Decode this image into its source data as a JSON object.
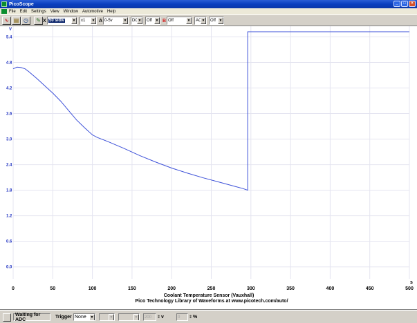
{
  "window": {
    "title": "PicoScope",
    "buttons": {
      "minimize": "_",
      "maximize": "□",
      "close": "×"
    }
  },
  "menu": [
    "File",
    "Edit",
    "Settings",
    "View",
    "Window",
    "Automotive",
    "Help"
  ],
  "toolbar": {
    "timebase": "50 s/div",
    "multiplier": "x1",
    "channel_a_label": "A",
    "channel_a_range": "0-5v",
    "channel_a_coupling": "DC",
    "channel_a_mode": "Off",
    "channel_b_label": "B",
    "channel_b_range": "Off",
    "channel_b_coupling": "AC",
    "channel_b_mode": "Off",
    "x_label": "X",
    "channel_a_color": "#1c3fd6",
    "channel_b_color": "#d42020"
  },
  "chart_data": {
    "type": "line",
    "title": "Coolant Temperature Sensor (Vauxhall)",
    "subtitle": "Pico Technology Library of Waveforms at www.picotech.com/auto/",
    "ylabel": "V",
    "xlabel": "s",
    "xlim": [
      0,
      500
    ],
    "ylim": [
      -0.28,
      5.65
    ],
    "xticks": [
      0,
      50,
      100,
      150,
      200,
      250,
      300,
      350,
      400,
      450,
      500
    ],
    "yticks": [
      "5.4",
      "4.8",
      "4.2",
      "3.6",
      "3.0",
      "2.4",
      "1.8",
      "1.2",
      "0.6",
      "0.0"
    ],
    "ytick_values": [
      5.4,
      4.8,
      4.2,
      3.6,
      3.0,
      2.4,
      1.8,
      1.2,
      0.6,
      0.0
    ],
    "grid": true,
    "series": [
      {
        "color": "#3b4fd8",
        "x": [
          0,
          5,
          10,
          15,
          20,
          30,
          40,
          50,
          60,
          70,
          80,
          90,
          100,
          106,
          120,
          140,
          160,
          180,
          200,
          220,
          240,
          260,
          280,
          290,
          296,
          296,
          300,
          400,
          500
        ],
        "y": [
          4.65,
          4.69,
          4.68,
          4.65,
          4.58,
          4.42,
          4.25,
          4.08,
          3.89,
          3.67,
          3.45,
          3.27,
          3.1,
          3.04,
          2.94,
          2.78,
          2.61,
          2.46,
          2.32,
          2.2,
          2.09,
          1.99,
          1.89,
          1.84,
          1.8,
          5.52,
          5.52,
          5.52,
          5.52
        ]
      }
    ]
  },
  "status": {
    "state": "Waiting for ADC",
    "trigger_label": "Trigger",
    "trigger_mode": "None",
    "delay_value": "200",
    "delay_unit": "v",
    "pct_value": "0",
    "pct_unit": "%"
  }
}
